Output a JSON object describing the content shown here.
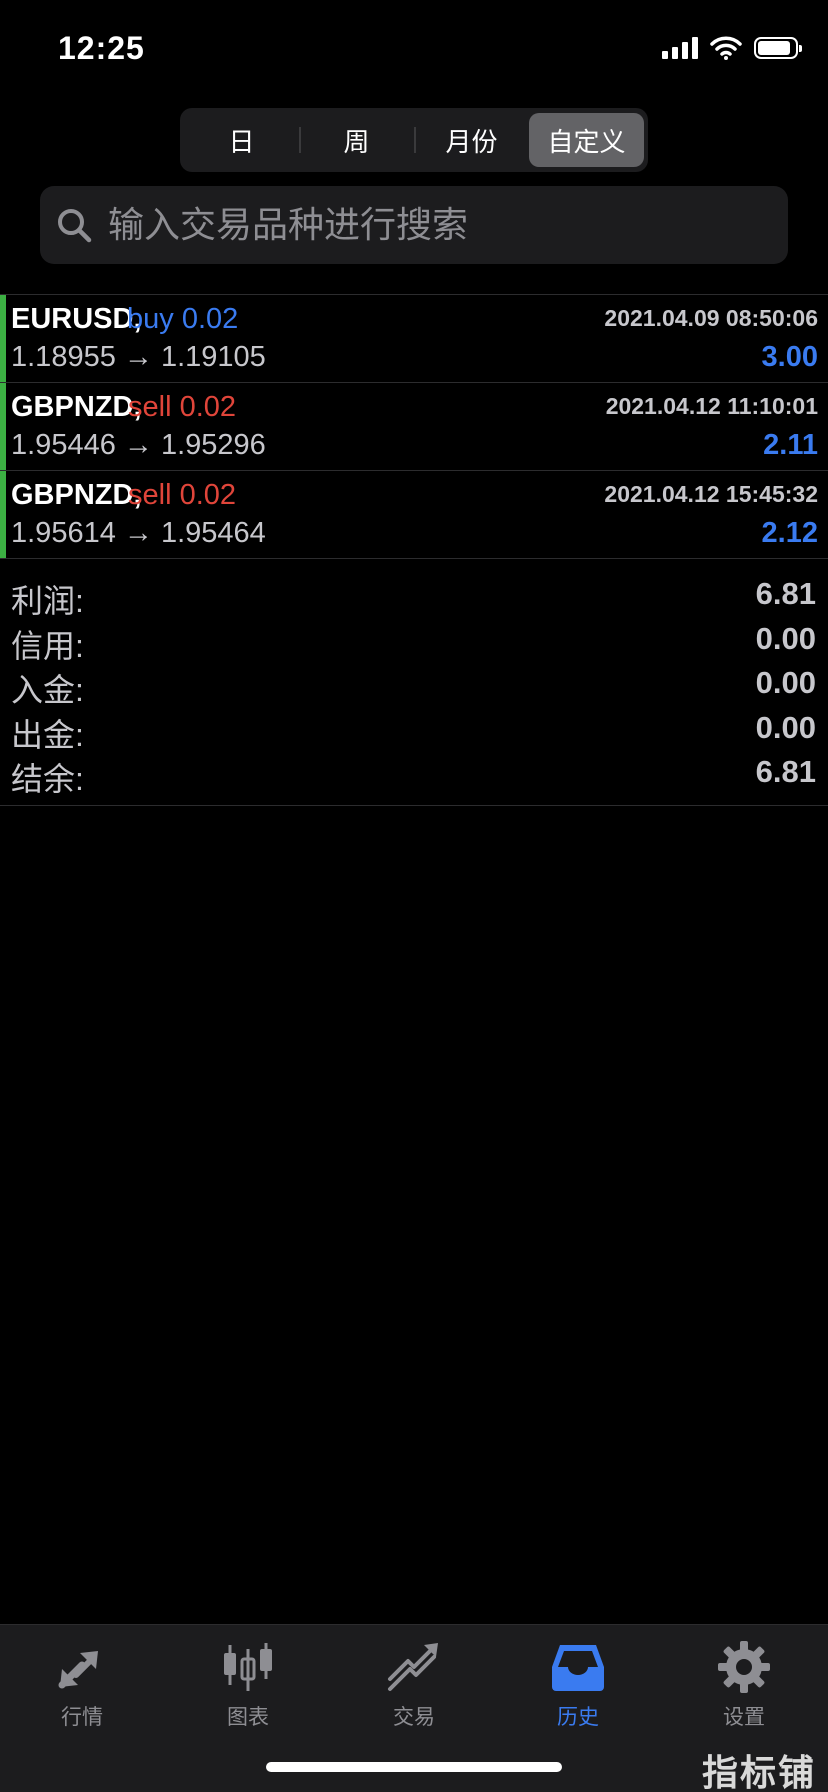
{
  "status_bar": {
    "time": "12:25"
  },
  "period_tabs": [
    {
      "label": "日",
      "active": false
    },
    {
      "label": "周",
      "active": false
    },
    {
      "label": "月份",
      "active": false
    },
    {
      "label": "自定义",
      "active": true
    }
  ],
  "search": {
    "placeholder": "输入交易品种进行搜索"
  },
  "trades": [
    {
      "symbol": "EURUSD,",
      "side": "buy 0.02",
      "time": "2021.04.09 08:50:06",
      "prices": "1.18955 → 1.19105",
      "profit": "3.00"
    },
    {
      "symbol": "GBPNZD,",
      "side": "sell 0.02",
      "time": "2021.04.12 11:10:01",
      "prices": "1.95446 → 1.95296",
      "profit": "2.11"
    },
    {
      "symbol": "GBPNZD,",
      "side": "sell 0.02",
      "time": "2021.04.12 15:45:32",
      "prices": "1.95614 → 1.95464",
      "profit": "2.12"
    }
  ],
  "summary": [
    {
      "label": "利润:",
      "value": "6.81"
    },
    {
      "label": "信用:",
      "value": "0.00"
    },
    {
      "label": "入金:",
      "value": "0.00"
    },
    {
      "label": "出金:",
      "value": "0.00"
    },
    {
      "label": "结余:",
      "value": "6.81"
    }
  ],
  "tabbar": [
    {
      "label": "行情",
      "icon": "quotes-icon",
      "active": false
    },
    {
      "label": "图表",
      "icon": "chart-candles-icon",
      "active": false
    },
    {
      "label": "交易",
      "icon": "trade-icon",
      "active": false
    },
    {
      "label": "历史",
      "icon": "history-inbox-icon",
      "active": true
    },
    {
      "label": "设置",
      "icon": "gear-icon",
      "active": false
    }
  ],
  "colors": {
    "accent_blue": "#3a7bf0",
    "sell_red": "#e0453a",
    "trade_marker_green": "#3cb043",
    "background": "#000000"
  },
  "watermark": "指标铺"
}
